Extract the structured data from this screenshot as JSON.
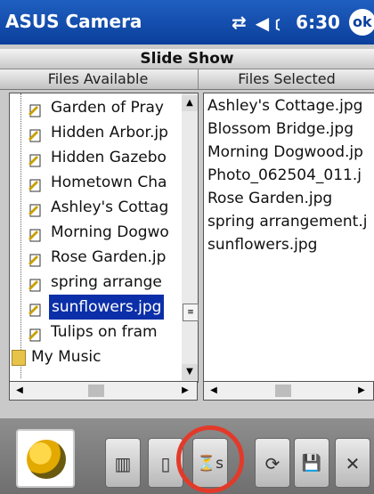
{
  "window": {
    "app_title": "ASUS Camera",
    "status_time": "6:30",
    "ok_label": "ok"
  },
  "headers": {
    "title": "Slide Show",
    "col_left": "Files Available",
    "col_right": "Files Selected"
  },
  "files_available": [
    {
      "label": "Garden of Pray",
      "selected": false
    },
    {
      "label": "Hidden Arbor.jp",
      "selected": false
    },
    {
      "label": "Hidden Gazebo",
      "selected": false
    },
    {
      "label": "Hometown Cha",
      "selected": false
    },
    {
      "label": "Ashley's Cottag",
      "selected": false
    },
    {
      "label": "Morning Dogwo",
      "selected": false
    },
    {
      "label": "Rose Garden.jp",
      "selected": false
    },
    {
      "label": "spring arrange",
      "selected": false
    },
    {
      "label": "sunflowers.jpg",
      "selected": true
    },
    {
      "label": "Tulips on fram",
      "selected": false
    },
    {
      "label": "My Music",
      "selected": false,
      "type": "folder"
    }
  ],
  "files_selected": [
    "Ashley's Cottage.jpg",
    "Blossom Bridge.jpg",
    "Morning Dogwood.jp",
    "Photo_062504_011.j",
    "Rose Garden.jpg",
    "spring arrangement.j",
    "sunflowers.jpg"
  ],
  "toolbar": {
    "buttons": [
      {
        "icon": "slideshow-icon",
        "glyph": "▥"
      },
      {
        "icon": "document-icon",
        "glyph": "▯"
      },
      {
        "icon": "timer-settings-icon",
        "glyph": "⏳s"
      },
      {
        "icon": "rotate-icon",
        "glyph": "⟳"
      },
      {
        "icon": "save-icon",
        "glyph": "💾"
      },
      {
        "icon": "close-icon",
        "glyph": "✕"
      }
    ],
    "highlight_color": "#e23a2a"
  }
}
